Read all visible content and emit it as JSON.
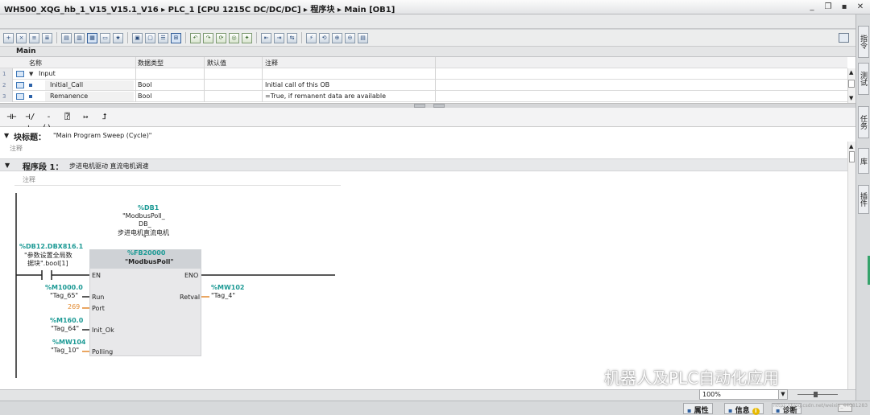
{
  "window": {
    "title": "WH500_XQG_hb_1_V15_V15.1_V16  ▸  PLC_1 [CPU 1215C DC/DC/DC]  ▸  程序块  ▸  Main [OB1]",
    "controls": [
      "_",
      "❐",
      "▪",
      "✕"
    ]
  },
  "block_name": "Main",
  "interface": {
    "columns": [
      "名称",
      "数据类型",
      "默认值",
      "注释"
    ],
    "rows": [
      {
        "num": "1",
        "name": "Input",
        "type": "",
        "default": "",
        "comment": ""
      },
      {
        "num": "2",
        "name": "Initial_Call",
        "type": "Bool",
        "default": "",
        "comment": "Initial call of this OB"
      },
      {
        "num": "3",
        "name": "Remanence",
        "type": "Bool",
        "default": "",
        "comment": "=True, if remanent data are available"
      }
    ]
  },
  "ladder_tools": [
    "⊣⊢",
    "⊣/⊢",
    "-()-",
    "⍰",
    "↦",
    "⮥"
  ],
  "block_title": {
    "label": "块标题：",
    "value": "\"Main Program Sweep (Cycle)\"",
    "comment": "注释"
  },
  "network": {
    "label": "程序段 1：",
    "title": "步进电机驱动 直流电机调速",
    "comment": "注释",
    "instance_db": {
      "address": "%DB1",
      "name_line1": "\"ModbusPoll_",
      "name_line2": "DB_",
      "name_line3": "步进电机直流电机",
      "name_line4": "\""
    },
    "contact": {
      "address": "%DB12.DBX816.1",
      "name_line1": "\"参数设置全局数",
      "name_line2": "据块\".bool[1]"
    },
    "fb": {
      "address": "%FB20000",
      "name": "\"ModbusPoll\"",
      "pin_en": "EN",
      "pin_eno": "ENO",
      "pin_run": "Run",
      "pin_port": "Port",
      "pin_initok": "Init_Ok",
      "pin_polling": "Polling",
      "pin_retval": "Retval"
    },
    "run_param": {
      "address": "%M1000.0",
      "tag": "\"Tag_65\""
    },
    "port_value": "269",
    "initok_param": {
      "address": "%M160.0",
      "tag": "\"Tag_64\""
    },
    "polling_param": {
      "address": "%MW104",
      "tag": "\"Tag_10\""
    },
    "retval_param": {
      "address": "%MW102",
      "tag": "\"Tag_4\""
    }
  },
  "zoom": "100%",
  "status_tabs": [
    "属性",
    "信息",
    "诊断"
  ],
  "right_tabs": [
    "指令",
    "测试",
    "任务",
    "库",
    "插件"
  ],
  "watermark": {
    "text": "机器人及PLC自动化应用",
    "url": "https://blog.csdn.net/weixin_44081283"
  }
}
